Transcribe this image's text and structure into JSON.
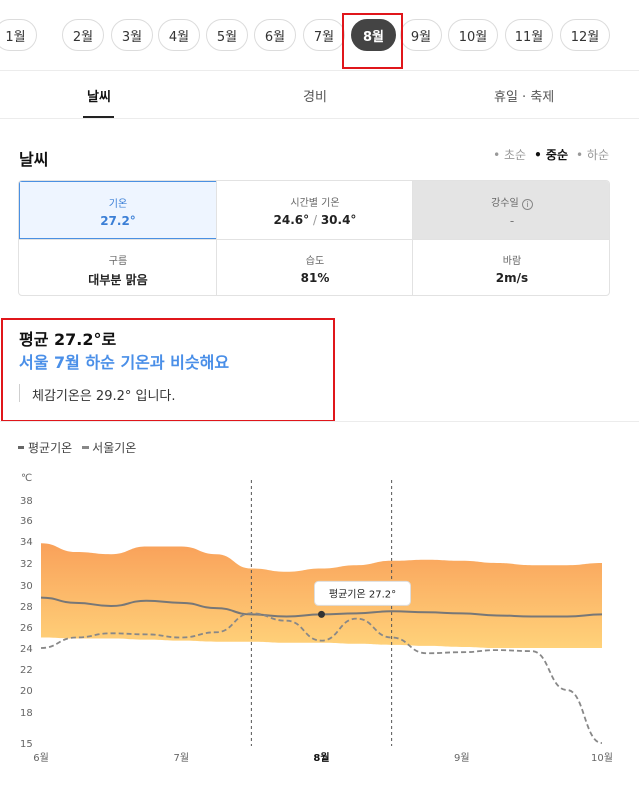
{
  "months": [
    "1월",
    "2월",
    "3월",
    "4월",
    "5월",
    "6월",
    "7월",
    "8월",
    "9월",
    "10월",
    "11월",
    "12월"
  ],
  "selected_month": "8월",
  "tabs": [
    {
      "label": "날씨",
      "active": true
    },
    {
      "label": "경비",
      "active": false
    },
    {
      "label": "휴일 · 축제",
      "active": false
    }
  ],
  "weather": {
    "title": "날씨",
    "periods": [
      {
        "label": "• 초순",
        "active": false
      },
      {
        "label": "• 중순",
        "active": true
      },
      {
        "label": "• 하순",
        "active": false
      }
    ],
    "cells": {
      "temp": {
        "label": "기온",
        "value": "27.2°"
      },
      "hourly": {
        "label": "시간별 기온",
        "min": "24.6°",
        "sep": " / ",
        "max": "30.4°"
      },
      "rain": {
        "label": "강수일",
        "value": "-"
      },
      "cloud": {
        "label": "구름",
        "value": "대부분 맑음"
      },
      "humidity": {
        "label": "습도",
        "value": "81%"
      },
      "wind": {
        "label": "바람",
        "value": "2m/s"
      }
    }
  },
  "summary": {
    "line1": "평균 27.2°로",
    "line2": "서울 7월 하순 기온과 비슷해요",
    "line3": "체감기온은 29.2° 입니다."
  },
  "legend": {
    "avg": "평균기온",
    "seoul": "서울기온"
  },
  "colors": {
    "accent": "#4a8fe8",
    "highlight": "#e0161b",
    "band_top": "#f9a15a",
    "band_bottom": "#ffd27a"
  },
  "chart_data": {
    "type": "area",
    "yunit": "℃",
    "yticks": [
      38,
      36,
      34,
      32,
      30,
      28,
      26,
      24,
      22,
      20,
      18,
      15
    ],
    "xticks": [
      "6월",
      "7월",
      "8월",
      "9월",
      "10월"
    ],
    "x": [
      0,
      0.25,
      0.5,
      0.75,
      1.0,
      1.25,
      1.5,
      1.75,
      2.0,
      2.25,
      2.5,
      2.75,
      3.0,
      3.25,
      3.5,
      3.75,
      4.0
    ],
    "series": [
      {
        "name": "max",
        "values": [
          33.8,
          33.0,
          32.8,
          33.5,
          33.5,
          32.8,
          31.5,
          31.2,
          31.5,
          31.8,
          32.2,
          32.3,
          32.2,
          32.0,
          31.8,
          31.8,
          32.0
        ]
      },
      {
        "name": "평균기온",
        "values": [
          28.8,
          28.3,
          28.0,
          28.5,
          28.3,
          27.8,
          27.2,
          27.0,
          27.2,
          27.3,
          27.5,
          27.4,
          27.3,
          27.1,
          27.0,
          27.0,
          27.2
        ]
      },
      {
        "name": "min",
        "values": [
          25.0,
          24.9,
          24.9,
          24.8,
          24.7,
          24.6,
          24.6,
          24.5,
          24.5,
          24.4,
          24.3,
          24.2,
          24.1,
          24.0,
          24.0,
          24.0,
          24.0
        ]
      },
      {
        "name": "서울기온",
        "values": [
          24.0,
          25.0,
          25.4,
          25.3,
          25.0,
          25.5,
          27.3,
          26.6,
          24.7,
          26.8,
          25.0,
          23.5,
          23.6,
          23.8,
          23.7,
          20.0,
          15.0
        ]
      }
    ],
    "markers": [
      {
        "x": 1.5,
        "label": "8월"
      },
      {
        "x": 2.5,
        "label": ""
      }
    ],
    "point": {
      "x": 2.0,
      "y": 27.2,
      "tooltip": "평균기온 27.2°"
    },
    "bold_xtick": "8월"
  }
}
